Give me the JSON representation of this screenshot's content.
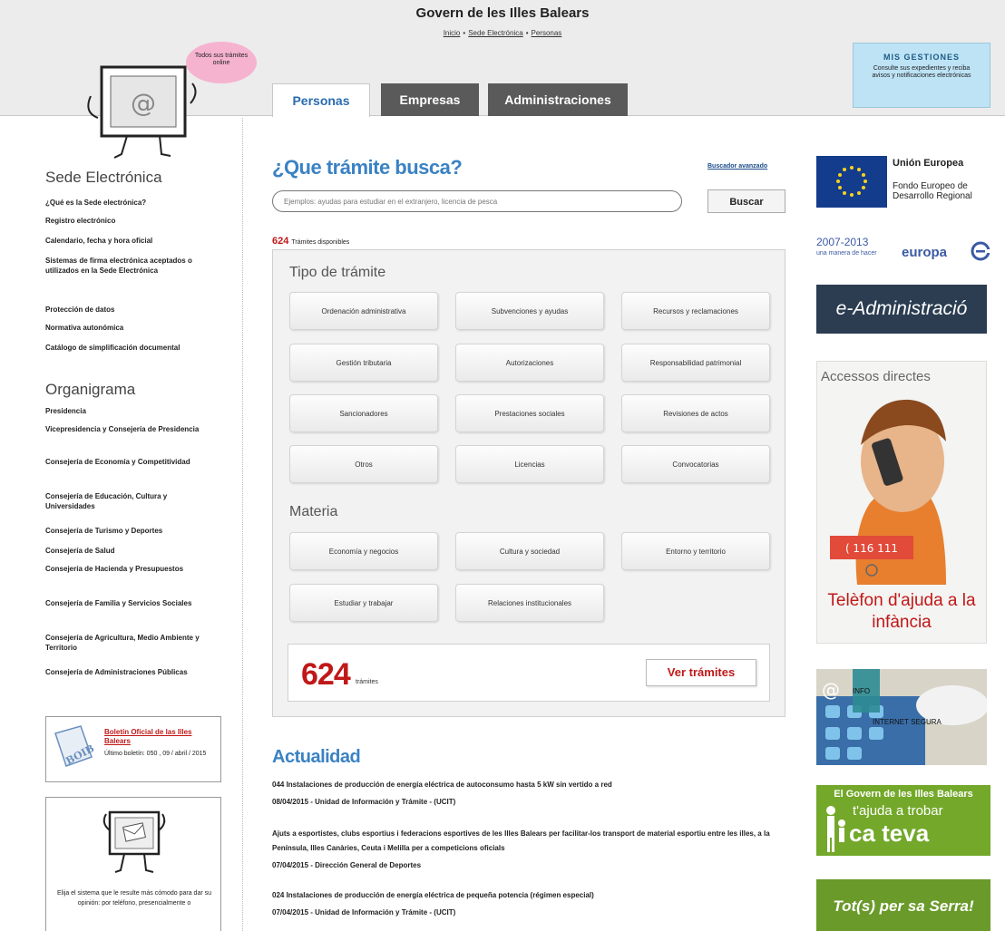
{
  "header": {
    "title": "Govern de les Illes Balears",
    "breadcrumb": [
      "Inicio",
      "Sede Electrónica",
      "Personas"
    ],
    "bubble_text": "Todos sus trámites online",
    "mis_gestiones": {
      "title": "MIS GESTIONES",
      "description": "Consulte sus expedientes y reciba avisos y notificaciones electrónicas"
    }
  },
  "tabs": [
    {
      "label": "Personas",
      "active": true
    },
    {
      "label": "Empresas",
      "active": false
    },
    {
      "label": "Administraciones",
      "active": false
    }
  ],
  "sidebar": {
    "section1_title": "Sede Electrónica",
    "section1_items": [
      "¿Qué es la Sede electrónica?",
      "Registro electrónico",
      "Calendario, fecha y hora oficial",
      "Sistemas de firma electrónica aceptados o utilizados en la Sede Electrónica",
      "Protección de datos",
      "Normativa autonómica",
      "Catálogo de simplificación documental"
    ],
    "section2_title": "Organigrama",
    "section2_items": [
      "Presidencia",
      "Vicepresidencia y Consejería de Presidencia",
      "Consejería de Economía y Competitividad",
      "Consejería de Educación, Cultura y Universidades",
      "Consejería de Turismo y Deportes",
      "Consejería de Salud",
      "Consejería de Hacienda y Presupuestos",
      "Consejería de Familia y Servicios Sociales",
      "Consejería de Agricultura, Medio Ambiente y Territorio",
      "Consejería de Administraciones Públicas"
    ],
    "boletin": {
      "link": "Boletín Oficial de las Illes Balears",
      "text": "Último boletín: 050 , 09 / abril / 2015"
    },
    "opinion_text": "Elija el sistema que le resulte más cómodo para dar su opinión: por teléfono, presencialmente o"
  },
  "main": {
    "search_title": "¿Que trámite busca?",
    "advanced_link": "Buscador avanzado",
    "search_placeholder": "Ejemplos: ayudas para estudiar en el extranjero, licencia de pesca",
    "search_button": "Buscar",
    "available_count": "624",
    "available_label": "Trámites disponibles",
    "tipo_title": "Tipo de trámite",
    "tipo_items": [
      "Ordenación administrativa",
      "Subvenciones y ayudas",
      "Recursos y reclamaciones",
      "Gestión tributaria",
      "Autorizaciones",
      "Responsabilidad patrimonial",
      "Sancionadores",
      "Prestaciones sociales",
      "Revisiones de actos",
      "Otros",
      "Licencias",
      "Convocatorias"
    ],
    "materia_title": "Materia",
    "materia_items": [
      "Economía y negocios",
      "Cultura y sociedad",
      "Entorno y territorio",
      "Estudiar y trabajar",
      "Relaciones institucionales"
    ],
    "count_big": "624",
    "count_small": "trámites",
    "ver_button": "Ver trámites",
    "actualidad_title": "Actualidad",
    "news": [
      {
        "title": "044 Instalaciones de producción de energía eléctrica de autoconsumo hasta 5 kW sin vertido a red",
        "meta": "08/04/2015 - Unidad de Información y Trámite - (UCIT)"
      },
      {
        "title": "Ajuts a esportistes, clubs esportius i federacions esportives de les Illes Balears per facilitar-los transport de material esportiu entre les illes, a la Península, Illes Canàries, Ceuta i Melilla per a competicions oficials",
        "meta": "07/04/2015 - Dirección General de Deportes"
      },
      {
        "title": "024 Instalaciones de producción de energía eléctrica de pequeña potencia (régimen especial)",
        "meta": "07/04/2015 - Unidad de Información y Trámite - (UCIT)"
      }
    ]
  },
  "right": {
    "eu_title": "Unión Europea",
    "eu_sub": "Fondo Europeo de Desarrollo Regional",
    "europa_years": "2007-2013",
    "europa_tag": "una manera de hacer",
    "europa_word": "europa",
    "eadmin": "e-Administració",
    "accessos": "Accessos directes",
    "telefon": "Telèfon d'ajuda a la infància",
    "info_a": "INFO",
    "info_b": "INTERNET SEGURA",
    "govern_1": "El Govern de les Illes Balears",
    "govern_2": "t'ajuda a trobar",
    "govern_3": "ca teva",
    "tot": "Tot(s) per sa Serra!"
  },
  "colors": {
    "accent_blue": "#3a82c4",
    "accent_red": "#c01818",
    "tab_dark": "#5a5a5a"
  }
}
